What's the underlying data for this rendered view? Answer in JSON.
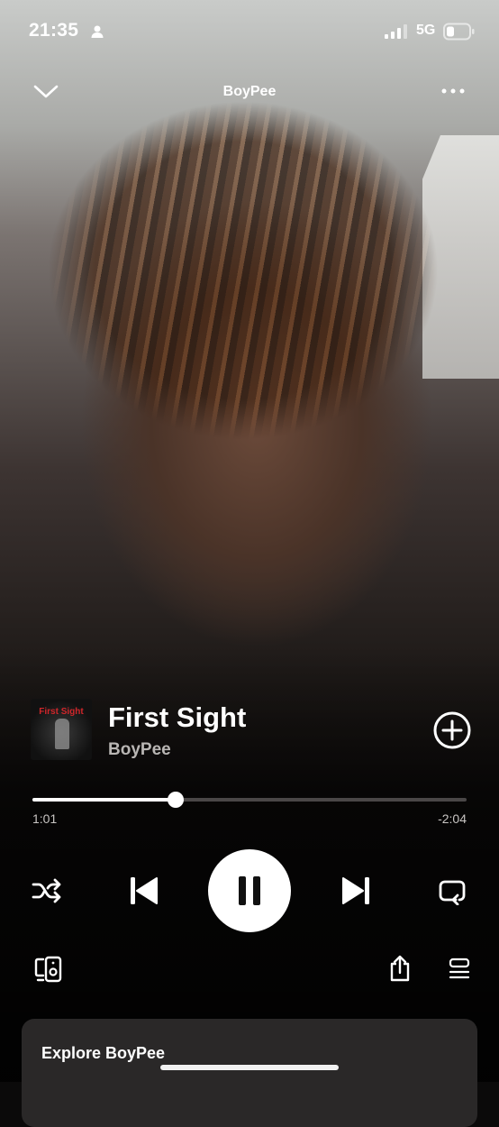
{
  "status_bar": {
    "time": "21:35",
    "network": "5G",
    "battery_level": 0.35
  },
  "header": {
    "title": "BoyPee"
  },
  "now_playing": {
    "cover_text": "First Sight",
    "title": "First Sight",
    "artist": "BoyPee"
  },
  "progress": {
    "elapsed": "1:01",
    "remaining": "-2:04",
    "fraction": 0.33
  },
  "controls": {
    "shuffle": "shuffle-icon",
    "previous": "skip-previous-icon",
    "play_pause": "pause-icon",
    "next": "skip-next-icon",
    "repeat": "repeat-icon"
  },
  "explore": {
    "title": "Explore BoyPee"
  },
  "colors": {
    "accent": "#ffffff",
    "track_bg": "#4a4747",
    "card_bg": "#2a2828",
    "cover_text": "#d0262a"
  }
}
